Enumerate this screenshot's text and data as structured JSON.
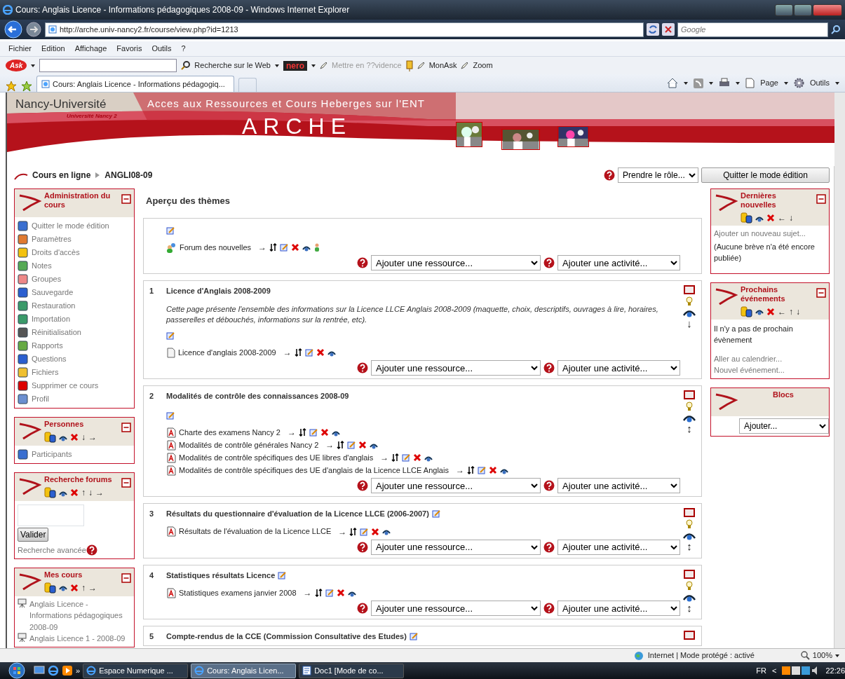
{
  "window": {
    "title": "Cours: Anglais Licence - Informations pédagogiques 2008-09 - Windows Internet Explorer"
  },
  "address_bar": {
    "url": "http://arche.univ-nancy2.fr/course/view.php?id=1213",
    "search_placeholder": "Google"
  },
  "menu": [
    "Fichier",
    "Edition",
    "Affichage",
    "Favoris",
    "Outils",
    "?"
  ],
  "ask_toolbar": {
    "logo": "Ask",
    "nero": "nero",
    "items": [
      {
        "label": "Recherche sur le Web",
        "disabled": false
      },
      {
        "label": "Mettre en ??vidence",
        "disabled": true
      },
      {
        "label": "MonAsk",
        "disabled": false
      },
      {
        "label": "Zoom",
        "disabled": false
      }
    ]
  },
  "tab": {
    "label": "Cours: Anglais Licence - Informations pédagogiq..."
  },
  "command_bar": [
    "Page",
    "Outils"
  ],
  "site": {
    "university": "Nancy-Université",
    "subtitle": "Université Nancy 2",
    "tagline": "Acces aux Ressources et Cours Heberges sur l'ENT",
    "brand": "ARCHE"
  },
  "breadcrumb": [
    "Cours en ligne",
    "ANGLI08-09"
  ],
  "role_select": "Prendre le rôle...",
  "edit_button": "Quitter le mode édition",
  "left_blocks": [
    {
      "title": "Administration du cours",
      "body": [
        {
          "kind": "icon_link",
          "label": "Quitter le mode édition"
        },
        {
          "kind": "icon_link",
          "label": "Paramètres"
        },
        {
          "kind": "icon_link",
          "label": "Droits d'accès"
        },
        {
          "kind": "icon_link",
          "label": "Notes"
        },
        {
          "kind": "icon_link",
          "label": "Groupes"
        },
        {
          "kind": "icon_link",
          "label": "Sauvegarde"
        },
        {
          "kind": "icon_link",
          "label": "Restauration"
        },
        {
          "kind": "icon_link",
          "label": "Importation"
        },
        {
          "kind": "icon_link",
          "label": "Réinitialisation"
        },
        {
          "kind": "icon_link",
          "label": "Rapports"
        },
        {
          "kind": "icon_link",
          "label": "Questions"
        },
        {
          "kind": "icon_link",
          "label": "Fichiers"
        },
        {
          "kind": "icon_link",
          "label": "Supprimer ce cours"
        },
        {
          "kind": "icon_link",
          "label": "Profil"
        }
      ]
    },
    {
      "title": "Personnes",
      "arrows": [
        "↓",
        "→"
      ],
      "body": [
        {
          "kind": "icon_link",
          "label": "Participants"
        }
      ]
    },
    {
      "title": "Recherche forums",
      "arrows": [
        "↑",
        "↓",
        "→"
      ],
      "body": [
        {
          "kind": "search",
          "button": "Valider",
          "link": "Recherche avancée"
        }
      ]
    },
    {
      "title": "Mes cours",
      "arrows": [
        "↑",
        "→"
      ],
      "body": [
        {
          "kind": "course_link",
          "label": "Anglais Licence - Informations pédagogiques 2008-09"
        },
        {
          "kind": "course_link",
          "label": "Anglais Licence 1 - 2008-09"
        }
      ]
    }
  ],
  "main": {
    "title": "Aperçu des thèmes",
    "sections": [
      {
        "edit_row": true,
        "activities": [
          {
            "kind": "forum",
            "label": "Forum des nouvelles",
            "indent": "→",
            "group": true
          }
        ],
        "resource_select": "Ajouter une ressource...",
        "activity_select": "Ajouter une activité..."
      },
      {
        "number": "1",
        "title": "Licence d'Anglais 2008-2009",
        "title_edit": false,
        "summary": "Cette page présente l'ensemble des informations sur la Licence LLCE Anglais 2008-2009 (maquette, choix, descriptifs, ouvrages à lire, horaires, passerelles et débouchés, informations sur la rentrée, etc).",
        "edit_row": true,
        "move": "↓",
        "activities": [
          {
            "kind": "file",
            "label": "Licence d'anglais 2008-2009",
            "indent": "→",
            "group": false
          }
        ],
        "resource_select": "Ajouter une ressource...",
        "activity_select": "Ajouter une activité..."
      },
      {
        "number": "2",
        "title": "Modalités de contrôle des connaissances 2008-09",
        "title_edit": false,
        "edit_row": true,
        "move": "↕",
        "activities": [
          {
            "kind": "pdf",
            "label": "Charte des examens Nancy 2",
            "indent": "→",
            "group": false
          },
          {
            "kind": "pdf",
            "label": "Modalités de contrôle générales Nancy 2",
            "indent": "→",
            "group": false
          },
          {
            "kind": "pdf",
            "label": "Modalités de contrôle spécifiques des UE libres d'anglais",
            "indent": "→",
            "group": false
          },
          {
            "kind": "pdf",
            "label": "Modalités de contrôle spécifiques des UE d'anglais de la Licence LLCE Anglais",
            "indent": "→",
            "group": false
          }
        ],
        "resource_select": "Ajouter une ressource...",
        "activity_select": "Ajouter une activité..."
      },
      {
        "number": "3",
        "title": "Résultats du questionnaire d'évaluation de la Licence LLCE (2006-2007)",
        "title_edit": true,
        "edit_row": false,
        "move": "↕",
        "activities": [
          {
            "kind": "pdf",
            "label": "Résultats de l'évaluation de la Licence LLCE",
            "indent": "→",
            "group": false
          }
        ],
        "resource_select": "Ajouter une ressource...",
        "activity_select": "Ajouter une activité..."
      },
      {
        "number": "4",
        "title": "Statistiques résultats Licence",
        "title_edit": true,
        "edit_row": false,
        "move": "↕",
        "activities": [
          {
            "kind": "pdf",
            "label": "Statistiques examens janvier 2008",
            "indent": "→",
            "group": false
          }
        ],
        "resource_select": "Ajouter une ressource...",
        "activity_select": "Ajouter une activité..."
      },
      {
        "number": "5",
        "title": "Compte-rendus de la CCE (Commission Consultative des Etudes)",
        "title_edit": true,
        "edit_row": false
      }
    ]
  },
  "right_blocks": [
    {
      "title": "Dernières nouvelles",
      "arrows": [
        "←",
        "↓"
      ],
      "body": [
        {
          "kind": "link",
          "label": "Ajouter un nouveau sujet..."
        },
        {
          "kind": "text",
          "label": "(Aucune brève n'a été encore publiée)"
        }
      ]
    },
    {
      "title": "Prochains événements",
      "arrows": [
        "←",
        "↑",
        "↓"
      ],
      "body": [
        {
          "kind": "text",
          "label": "Il n'y a pas de prochain évènement"
        },
        {
          "kind": "link",
          "label": "Aller au calendrier..."
        },
        {
          "kind": "link",
          "label": "Nouvel événement..."
        }
      ]
    },
    {
      "title": "Blocs",
      "plain": true,
      "body": [
        {
          "kind": "select",
          "label": "Ajouter..."
        }
      ]
    }
  ],
  "status_bar": {
    "zone": "Internet | Mode protégé : activé",
    "zoom": "100%"
  },
  "taskbar": {
    "overflow": "»",
    "items": [
      {
        "label": "Espace Numerique ...",
        "selected": false
      },
      {
        "label": "Cours: Anglais Licen...",
        "selected": true
      },
      {
        "label": "Doc1 [Mode de co...",
        "selected": false
      }
    ],
    "language": "FR",
    "tray_arrow": "<",
    "clock": "22:26"
  }
}
